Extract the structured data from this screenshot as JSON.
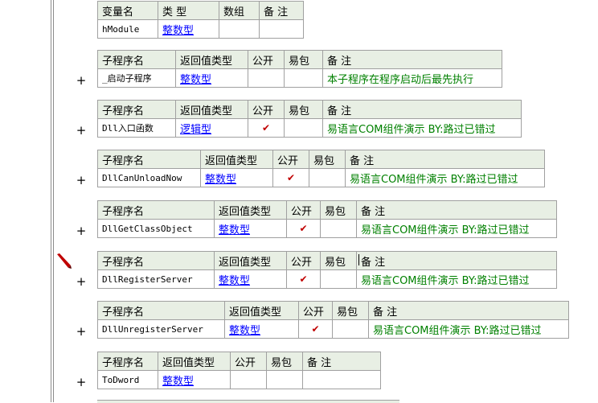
{
  "var_table": {
    "headers": [
      "变量名",
      "类 型",
      "数组",
      "备 注"
    ],
    "row": {
      "name": "hModule",
      "type": "整数型",
      "array": "",
      "remark": ""
    }
  },
  "sub_headers": [
    "子程序名",
    "返回值类型",
    "公开",
    "易包",
    "备 注"
  ],
  "expand_symbol": "+",
  "public_check": "✔",
  "subs": [
    {
      "name": "_启动子程序",
      "type": "整数型",
      "public": "",
      "pkg": "",
      "remark": "本子程序在程序启动后最先执行"
    },
    {
      "name": "Dll入口函数",
      "type": "逻辑型",
      "public": "✔",
      "pkg": "",
      "remark": "易语言COM组件演示 BY:路过已错过"
    },
    {
      "name": "DllCanUnloadNow",
      "type": "整数型",
      "public": "✔",
      "pkg": "",
      "remark": "易语言COM组件演示 BY:路过已错过"
    },
    {
      "name": "DllGetClassObject",
      "type": "整数型",
      "public": "✔",
      "pkg": "",
      "remark": "易语言COM组件演示 BY:路过已错过"
    },
    {
      "name": "DllRegisterServer",
      "type": "整数型",
      "public": "✔",
      "pkg": "",
      "remark": "易语言COM组件演示 BY:路过已错过"
    },
    {
      "name": "DllUnregisterServer",
      "type": "整数型",
      "public": "✔",
      "pkg": "",
      "remark": "易语言COM组件演示 BY:路过已错过"
    },
    {
      "name": "ToDword",
      "type": "整数型",
      "public": "",
      "pkg": "",
      "remark": ""
    }
  ],
  "colors": {
    "header_bg": "#e8efe4",
    "type_link": "#0000ff",
    "remark": "#008000",
    "check": "#c00000",
    "pencil": "#c00000"
  },
  "icons": {
    "pencil": "pencil-icon",
    "expand": "plus-icon"
  }
}
